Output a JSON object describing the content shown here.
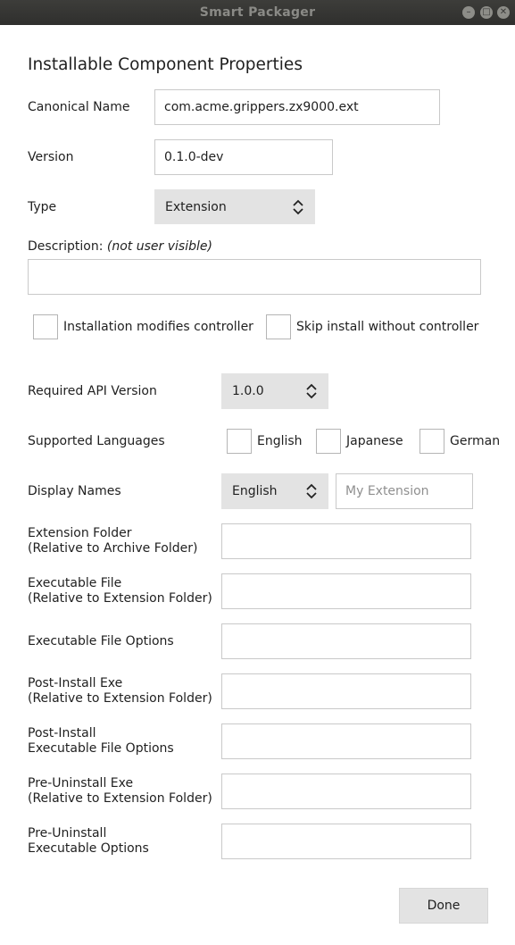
{
  "window": {
    "title": "Smart Packager"
  },
  "heading": "Installable Component Properties",
  "canonical_name": {
    "label": "Canonical Name",
    "value": "com.acme.grippers.zx9000.ext"
  },
  "version": {
    "label": "Version",
    "value": "0.1.0-dev"
  },
  "type": {
    "label": "Type",
    "value": "Extension"
  },
  "description": {
    "label": "Description:",
    "note": "(not user visible)",
    "value": ""
  },
  "options": {
    "modifies_controller": {
      "label": "Installation modifies controller",
      "checked": false
    },
    "skip_install": {
      "label": "Skip install without controller",
      "checked": false
    }
  },
  "api_version": {
    "label": "Required API Version",
    "value": "1.0.0"
  },
  "languages": {
    "label": "Supported Languages",
    "items": [
      {
        "label": "English",
        "checked": false
      },
      {
        "label": "Japanese",
        "checked": false
      },
      {
        "label": "German",
        "checked": false
      }
    ]
  },
  "display_names": {
    "label": "Display Names",
    "language": "English",
    "placeholder": "My Extension"
  },
  "extension_folder": {
    "line1": "Extension Folder",
    "line2": "(Relative to Archive Folder)",
    "value": ""
  },
  "executable_file": {
    "line1": "Executable File",
    "line2": "(Relative to Extension Folder)",
    "value": ""
  },
  "executable_options": {
    "line1": "Executable File Options",
    "value": ""
  },
  "post_install_exe": {
    "line1": "Post-Install Exe",
    "line2": "(Relative to Extension Folder)",
    "value": ""
  },
  "post_install_options": {
    "line1": "Post-Install",
    "line2": "Executable File Options",
    "value": ""
  },
  "pre_uninstall_exe": {
    "line1": "Pre-Uninstall Exe",
    "line2": "(Relative to Extension Folder)",
    "value": ""
  },
  "pre_uninstall_options": {
    "line1": "Pre-Uninstall",
    "line2": "Executable Options",
    "value": ""
  },
  "done_button": "Done"
}
